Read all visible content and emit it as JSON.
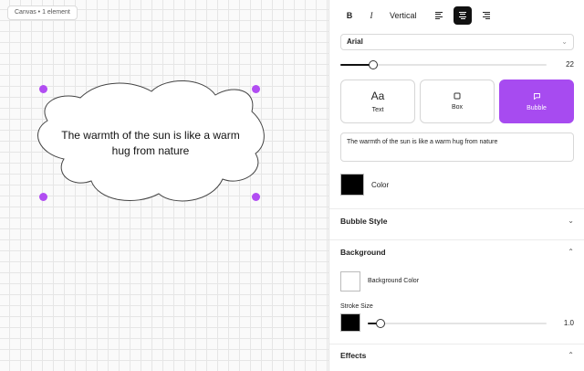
{
  "canvas": {
    "info_label": "Canvas • 1 element",
    "bubble_text": "The warmth of the sun is like a warm hug from nature"
  },
  "toolbar": {
    "bold_label": "B",
    "italic_label": "I",
    "vertical_label": "Vertical",
    "selected_alignment": "center"
  },
  "font": {
    "family": "Arial",
    "size_value": "22",
    "size_fraction": 0.16
  },
  "element_types": [
    {
      "icon": "Aa",
      "label": "Text",
      "selected": false
    },
    {
      "icon": "box",
      "label": "Box",
      "selected": false
    },
    {
      "icon": "bubble",
      "label": "Bubble",
      "selected": true
    }
  ],
  "text_input": {
    "value": "The warmth of the sun is like a warm hug from nature"
  },
  "color": {
    "label": "Color",
    "value": "#000000"
  },
  "sections": {
    "bubble_style": "Bubble Style",
    "background": "Background",
    "effects": "Effects"
  },
  "background": {
    "color_label": "Background Color",
    "color_value": "#ffffff",
    "stroke_size_label": "Stroke Size",
    "stroke_color": "#000000",
    "stroke_value": "1.0",
    "stroke_fraction": 0.07
  },
  "theme": {
    "accent": "#a74bf0",
    "handle": "#b14df2"
  }
}
